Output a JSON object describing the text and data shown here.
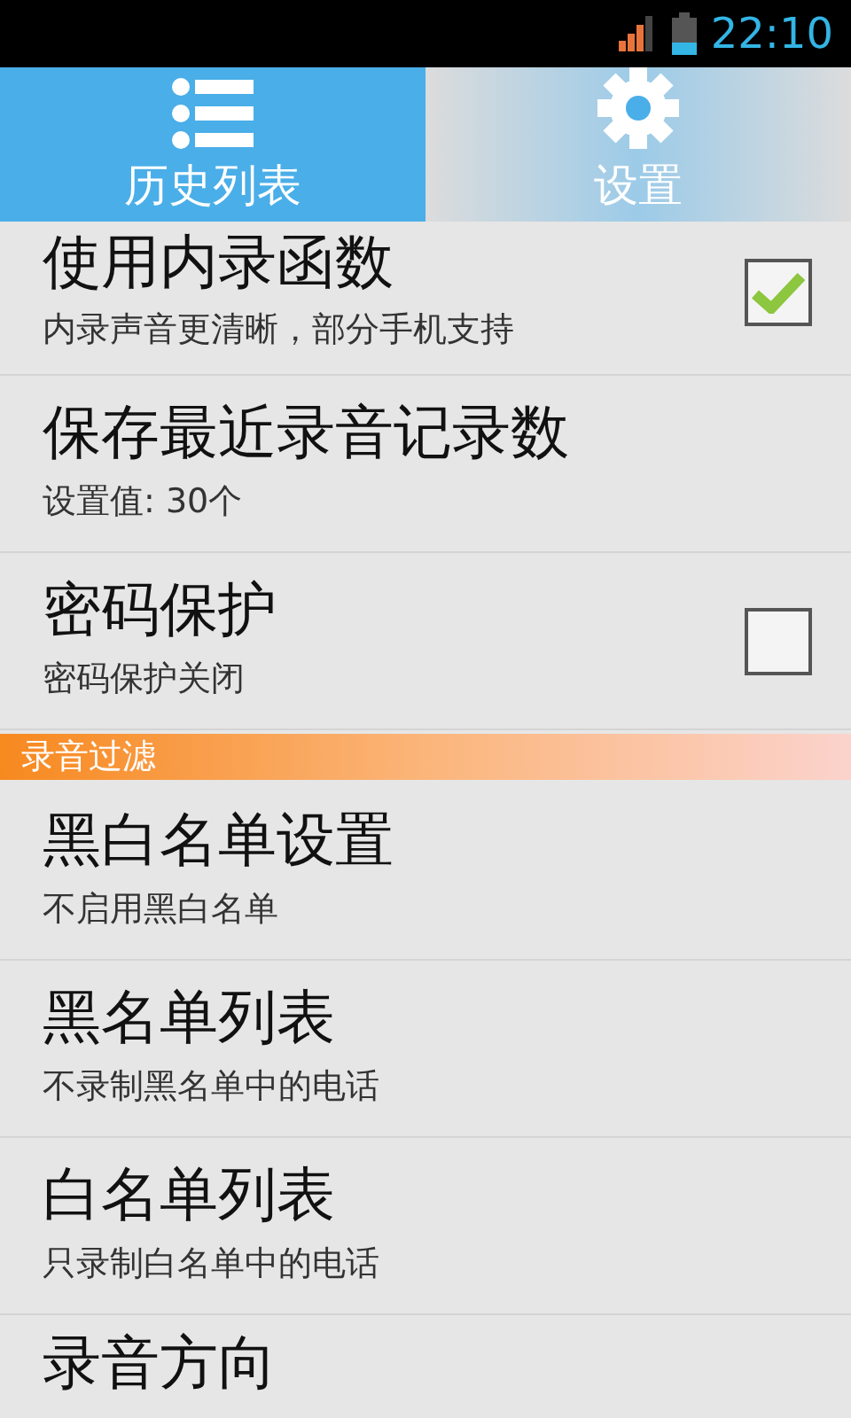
{
  "status_bar": {
    "time": "22:10"
  },
  "tabs": [
    {
      "label": "历史列表",
      "kind": "list",
      "selected": true
    },
    {
      "label": "设置",
      "kind": "gear",
      "selected": false
    }
  ],
  "settings": [
    {
      "kind": "checkbox",
      "title": "使用内录函数",
      "summary": "内录声音更清晰，部分手机支持",
      "checked": true
    },
    {
      "kind": "plain",
      "title": "保存最近录音记录数",
      "summary": "设置值: 30个"
    },
    {
      "kind": "checkbox",
      "title": "密码保护",
      "summary": "密码保护关闭",
      "checked": false
    },
    {
      "kind": "header",
      "title": "录音过滤"
    },
    {
      "kind": "plain",
      "title": "黑白名单设置",
      "summary": "不启用黑白名单"
    },
    {
      "kind": "plain",
      "title": "黑名单列表",
      "summary": "不录制黑名单中的电话"
    },
    {
      "kind": "plain",
      "title": "白名单列表",
      "summary": "只录制白名单中的电话"
    },
    {
      "kind": "plain",
      "title": "录音方向"
    }
  ]
}
